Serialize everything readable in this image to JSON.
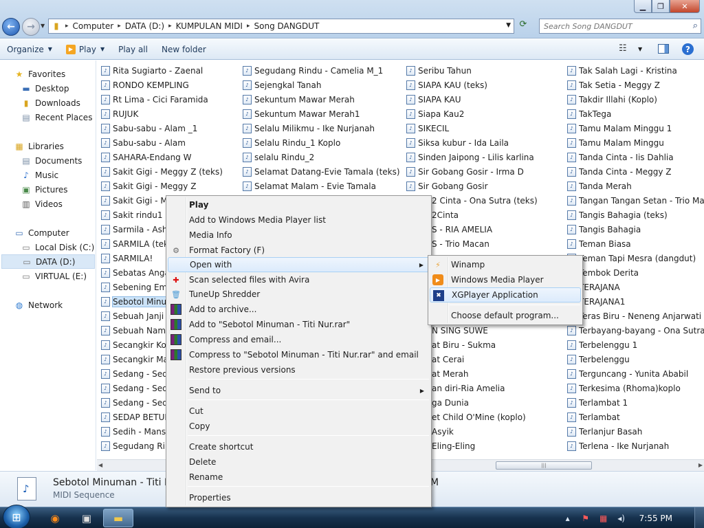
{
  "address": {
    "crumbs": [
      "Computer",
      "DATA (D:)",
      "KUMPULAN MIDI",
      "Song DANGDUT"
    ],
    "search_placeholder": "Search Song DANGDUT"
  },
  "toolbar": {
    "organize": "Organize",
    "play": "Play",
    "play_all": "Play all",
    "new_folder": "New folder"
  },
  "nav": {
    "favorites": "Favorites",
    "desktop": "Desktop",
    "downloads": "Downloads",
    "recent": "Recent Places",
    "libraries": "Libraries",
    "documents": "Documents",
    "music": "Music",
    "pictures": "Pictures",
    "videos": "Videos",
    "computer": "Computer",
    "local_disk": "Local Disk (C:)",
    "data": "DATA (D:)",
    "virtual": "VIRTUAL (E:)",
    "network": "Network"
  },
  "files": {
    "col1": [
      "Rita Sugiarto - Zaenal",
      "RONDO KEMPLING",
      "Rt Lima - Cici Faramida",
      "RUJUK",
      "Sabu-sabu - Alam _1",
      "Sabu-sabu - Alam",
      "SAHARA-Endang W",
      "Sakit Gigi - Meggy Z (teks)",
      "Sakit Gigi - Meggy Z",
      "Sakit Gigi - Me",
      "Sakit rindu1",
      "Sarmila - Ashra",
      "SARMILA (teks",
      "SARMILA!",
      "Sebatas Angan",
      "Sebening Emb",
      "Sebotol Minum",
      "Sebuah Janji",
      "Sebuah Nama",
      "Secangkir Kop",
      "Secangkir Mad",
      "Sedang - Seda",
      "Sedang - Seda",
      "Sedang - Seda",
      "SEDAP BETUL",
      "Sedih - Mansy",
      "Segudang Rind"
    ],
    "col2": [
      "Segudang Rindu - Camelia M_1",
      "Sejengkal  Tanah",
      "Sekuntum Mawar Merah",
      "Sekuntum Mawar Merah1",
      "Selalu Milikmu - Ike Nurjanah",
      "Selalu Rindu_1 Koplo",
      "selalu Rindu_2",
      "Selamat Datang-Evie Tamala (teks)",
      "Selamat Malam - Evie Tamala"
    ],
    "col3_top": [
      "Seribu Tahun",
      "SIAPA KAU (teks)",
      "SIAPA KAU",
      "Siapa Kau2",
      "SIKECIL",
      "Siksa kubur - Ida Laila",
      "Sinden Jaipong - Lilis karlina",
      "Sir Gobang Gosir - Irma D",
      "Sir Gobang Gosir"
    ],
    "col3_partial": [
      "2 Cinta - Ona Sutra (teks)",
      "2Cinta",
      "S - RIA AMELIA",
      "S - Trio Macan"
    ],
    "col3_bottom": [
      "N SING SUWE",
      "at Biru - Sukma",
      "at Cerai",
      "at Merah",
      "an diri-Ria Amelia",
      "ga Dunia",
      "et Child O'Mine (koplo)",
      "Asyik",
      "Eling-Eling"
    ],
    "col4": [
      "Tak Salah Lagi - Kristina",
      "Tak Setia - Meggy Z",
      "Takdir Illahi (Koplo)",
      "TakTega",
      "Tamu Malam Minggu 1",
      "Tamu Malam Minggu",
      "Tanda Cinta - Iis Dahlia",
      "Tanda Cinta - Meggy Z",
      "Tanda Merah",
      "Tangan Tangan Setan - Trio Macan",
      "Tangis Bahagia (teks)",
      "Tangis Bahagia",
      "Teman Biasa",
      "Teman Tapi Mesra (dangdut)",
      "Tembok Derita",
      "TERAJANA",
      "TERAJANA1",
      "Teras Biru - Neneng Anjarwati",
      "Terbayang-bayang - Ona Sutra",
      "Terbelenggu 1",
      "Terbelenggu",
      "Terguncang - Yunita Ababil",
      "Terkesima (Rhoma)koplo",
      "Terlambat 1",
      "Terlambat",
      "Terlanjur Basah",
      "Terlena - Ike Nurjanah"
    ]
  },
  "context_menu": {
    "play": "Play",
    "add_wmp": "Add to Windows Media Player list",
    "media_info": "Media Info",
    "format_factory": "Format Factory (F)",
    "open_with": "Open with",
    "scan_avira": "Scan selected files with Avira",
    "tuneup": "TuneUp Shredder",
    "add_archive": "Add to archive...",
    "add_rar": "Add to \"Sebotol Minuman - Titi Nur.rar\"",
    "compress_email": "Compress and email...",
    "compress_rar_email": "Compress to \"Sebotol Minuman - Titi Nur.rar\" and email",
    "restore": "Restore previous versions",
    "send_to": "Send to",
    "cut": "Cut",
    "copy": "Copy",
    "create_shortcut": "Create shortcut",
    "delete": "Delete",
    "rename": "Rename",
    "properties": "Properties"
  },
  "submenu": {
    "winamp": "Winamp",
    "wmp": "Windows Media Player",
    "xgplayer": "XGPlayer Application",
    "choose": "Choose default program..."
  },
  "details": {
    "name": "Sebotol Minuman - Titi Nur",
    "type": "MIDI Sequence",
    "right_partial": "M"
  },
  "taskbar": {
    "clock": "7:55 PM"
  }
}
